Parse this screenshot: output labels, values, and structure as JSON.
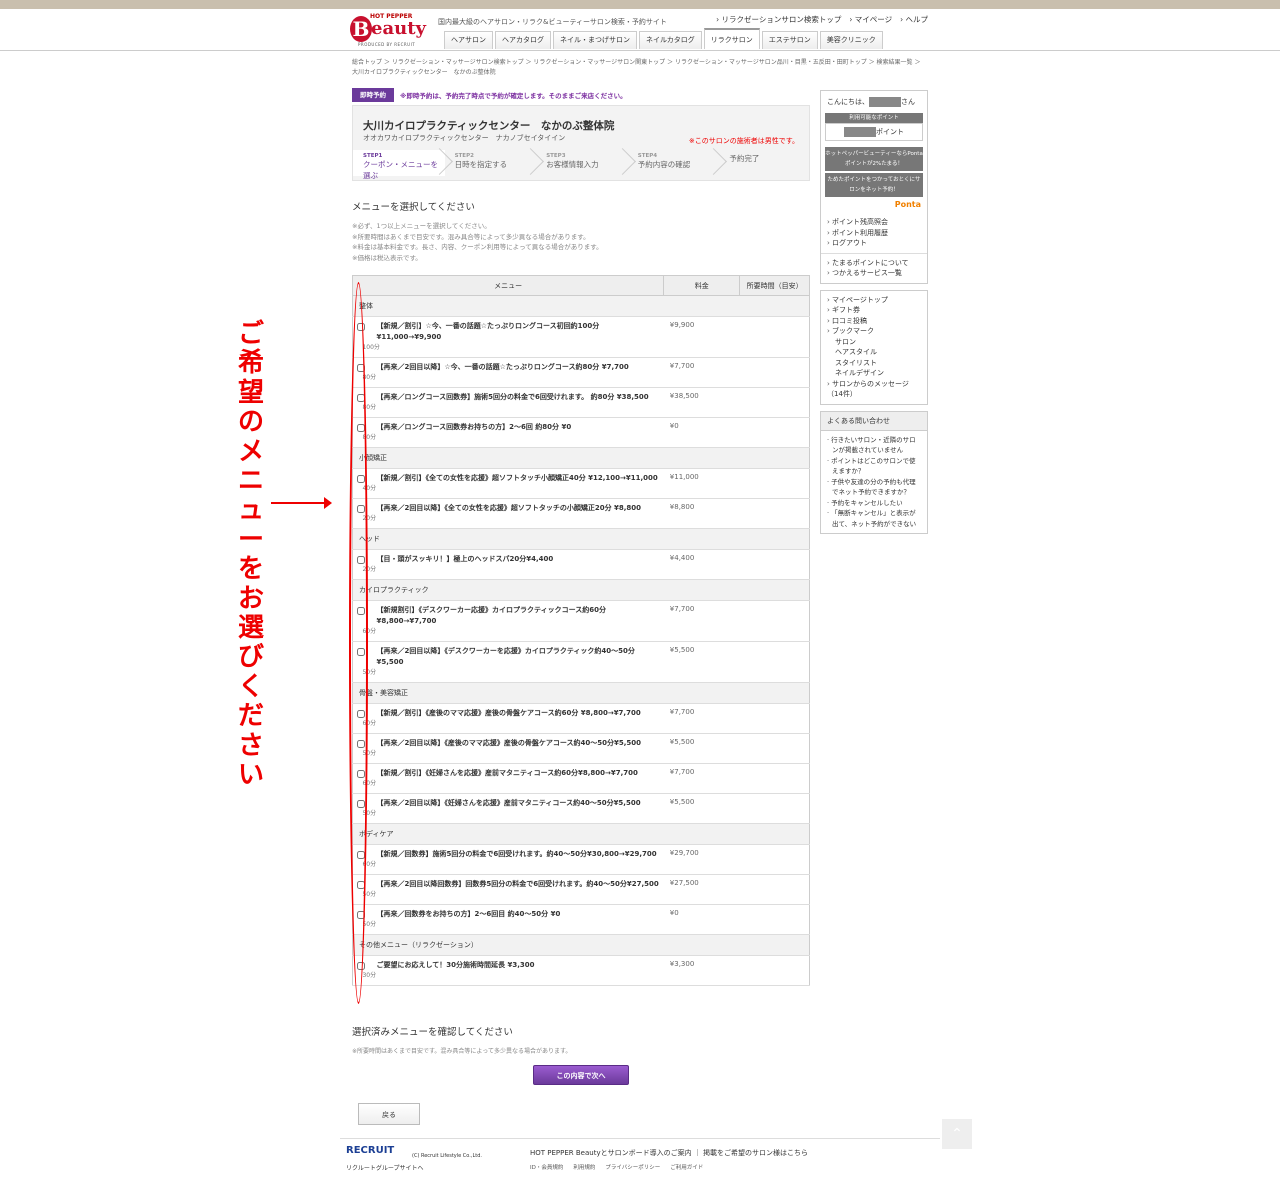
{
  "header": {
    "logo_top": "HOT PEPPER",
    "logo_b": "B",
    "logo_main": "eauty",
    "logo_sub": "PRODUCED BY RECRUIT",
    "tagline": "国内最大級のヘアサロン・リラク&ビューティーサロン検索・予約サイト",
    "toplinks": [
      "リラクゼーションサロン検索トップ",
      "マイページ",
      "ヘルプ"
    ],
    "tabs": [
      "ヘアサロン",
      "ヘアカタログ",
      "ネイル・まつげサロン",
      "ネイルカタログ",
      "リラクサロン",
      "エステサロン",
      "美容クリニック"
    ]
  },
  "breadcrumb": "総合トップ ＞ リラクゼーション・マッサージサロン検索トップ ＞ リラクゼーション・マッサージサロン関東トップ ＞ リラクゼーション・マッサージサロン品川・目黒・五反田・田町トップ ＞ 検索結果一覧 ＞ 大川カイロプラクティックセンター　なかのぶ整体院",
  "instant": {
    "badge": "即時予約",
    "text": "※即時予約は、予約完了時点で予約が確定します。そのままご来店ください。"
  },
  "salon": {
    "name": "大川カイロプラクティックセンター　なかのぶ整体院",
    "kana": "オオカワカイロプラクティックセンター　ナカノブセイタイイン",
    "note": "※このサロンの施術者は男性です。"
  },
  "steps": [
    {
      "num": "STEP1",
      "label": "クーポン・メニューを選ぶ"
    },
    {
      "num": "STEP2",
      "label": "日時を指定する"
    },
    {
      "num": "STEP3",
      "label": "お客様情報入力"
    },
    {
      "num": "STEP4",
      "label": "予約内容の確認"
    },
    {
      "num": "",
      "label": "予約完了"
    }
  ],
  "section_title": "メニューを選択してください",
  "notes": [
    "※必ず、1つ以上メニューを選択してください。",
    "※所要時間はあくまで目安です。混み具合等によって多少異なる場合があります。",
    "※料金は基本料金です。長さ、内容、クーポン利用等によって異なる場合があります。",
    "※価格は税込表示です。"
  ],
  "table": {
    "headers": [
      "メニュー",
      "料金",
      "所要時間（目安）"
    ],
    "categories": [
      {
        "name": "整体",
        "items": [
          {
            "title": "【新規／割引】☆今、一番の話題☆たっぷりロングコース初回約100分 ¥11,000→¥9,900",
            "duration": "100分",
            "price": "¥9,900"
          },
          {
            "title": "【再来／2回目以降】☆今、一番の話題☆たっぷりロングコース約80分 ¥7,700",
            "duration": "80分",
            "price": "¥7,700"
          },
          {
            "title": "【再来／ロングコース回数券】施術5回分の料金で6回受けれます。 約80分 ¥38,500",
            "duration": "80分",
            "price": "¥38,500"
          },
          {
            "title": "【再来／ロングコース回数券お持ちの方】2〜6回 約80分 ¥0",
            "duration": "80分",
            "price": "¥0"
          }
        ]
      },
      {
        "name": "小顔矯正",
        "items": [
          {
            "title": "【新規／割引】《全ての女性を応援》超ソフトタッチ小顔矯正40分 ¥12,100→¥11,000",
            "duration": "40分",
            "price": "¥11,000"
          },
          {
            "title": "【再来／2回目以降】《全ての女性を応援》超ソフトタッチの小顔矯正20分 ¥8,800",
            "duration": "20分",
            "price": "¥8,800"
          }
        ]
      },
      {
        "name": "ヘッド",
        "items": [
          {
            "title": "【目・頭がスッキリ！】極上のヘッドスパ20分¥4,400",
            "duration": "20分",
            "price": "¥4,400"
          }
        ]
      },
      {
        "name": "カイロプラクティック",
        "items": [
          {
            "title": "【新規割引】《デスクワーカー応援》カイロプラクティックコース約60分¥8,800→¥7,700",
            "duration": "60分",
            "price": "¥7,700"
          },
          {
            "title": "【再来／2回目以降】《デスクワーカーを応援》カイロプラクティック約40〜50分¥5,500",
            "duration": "50分",
            "price": "¥5,500"
          }
        ]
      },
      {
        "name": "骨盤・美容矯正",
        "items": [
          {
            "title": "【新規／割引】《産後のママ応援》産後の骨盤ケアコース約60分 ¥8,800→¥7,700",
            "duration": "60分",
            "price": "¥7,700"
          },
          {
            "title": "【再来／2回目以降】《産後のママ応援》産後の骨盤ケアコース約40〜50分¥5,500",
            "duration": "50分",
            "price": "¥5,500"
          },
          {
            "title": "【新規／割引】《妊婦さんを応援》産前マタニティコース約60分¥8,800→¥7,700",
            "duration": "60分",
            "price": "¥7,700"
          },
          {
            "title": "【再来／2回目以降】《妊婦さんを応援》産前マタニティコース約40〜50分¥5,500",
            "duration": "50分",
            "price": "¥5,500"
          }
        ]
      },
      {
        "name": "ボディケア",
        "items": [
          {
            "title": "【新規／回数券】施術5回分の料金で6回受けれます。約40〜50分¥30,800→¥29,700",
            "duration": "60分",
            "price": "¥29,700"
          },
          {
            "title": "【再来／2回目以降回数券】回数券5回分の料金で6回受けれます。約40〜50分¥27,500",
            "duration": "50分",
            "price": "¥27,500"
          },
          {
            "title": "【再来／回数券をお持ちの方】2〜6回目 約40〜50分 ¥0",
            "duration": "50分",
            "price": "¥0"
          }
        ]
      },
      {
        "name": "その他メニュー（リラクゼーション）",
        "items": [
          {
            "title": "ご要望にお応えして！30分施術時間延長 ¥3,300",
            "duration": "30分",
            "price": "¥3,300"
          }
        ]
      }
    ]
  },
  "confirm_title": "選択済みメニューを確認してください",
  "confirm_note": "※所要時間はあくまで目安です。混み具合等によって多少異なる場合があります。",
  "next_button": "この内容で次へ",
  "back_button": "戻る",
  "sidebar": {
    "greeting_pre": "こんにちは、",
    "greeting_post": "さん",
    "points_label": "利用可能なポイント",
    "points_suffix": "ポイント",
    "ponta_1": "ホットペッパービューティーならPontaポイントが2%たまる！",
    "ponta_2": "ためたポイントをつかっておとくにサロンをネット予約！",
    "ponta_logo": "Ponta",
    "links_1": [
      "ポイント残高照会",
      "ポイント利用履歴",
      "ログアウト"
    ],
    "links_2": [
      "たまるポイントについて",
      "つかえるサービス一覧"
    ],
    "links_3": [
      "マイページトップ",
      "ギフト券",
      "口コミ投稿",
      "ブックマーク"
    ],
    "bookmark_sub": [
      "サロン",
      "ヘアスタイル",
      "スタイリスト",
      "ネイルデザイン"
    ],
    "messages_link": "サロンからのメッセージ（14件）",
    "faq_title": "よくある問い合わせ",
    "faq": [
      "行きたいサロン・近隣のサロンが掲載されていません",
      "ポイントはどこのサロンで使えますか？",
      "子供や友達の分の予約も代理でネット予約できますか？",
      "予約をキャンセルしたい",
      "「無断キャンセル」と表示が出て、ネット予約ができない"
    ]
  },
  "footer": {
    "logo": "RECRUIT",
    "copyright": "(C) Recruit Lifestyle Co.,Ltd.",
    "group": "リクルートグループサイトへ",
    "link1": "HOT PEPPER Beautyとサロンボード導入のご案内 ｜ 掲載をご希望のサロン様はこちら",
    "links": [
      "ID・会員規約",
      "利用規約",
      "プライバシーポリシー",
      "ご利用ガイド"
    ]
  },
  "annotation": {
    "text": "ご希望のメニューをお選びください",
    "color": "#e00000"
  },
  "colors": {
    "accent_purple": "#6b3a9b",
    "alert_red": "#e00000"
  }
}
